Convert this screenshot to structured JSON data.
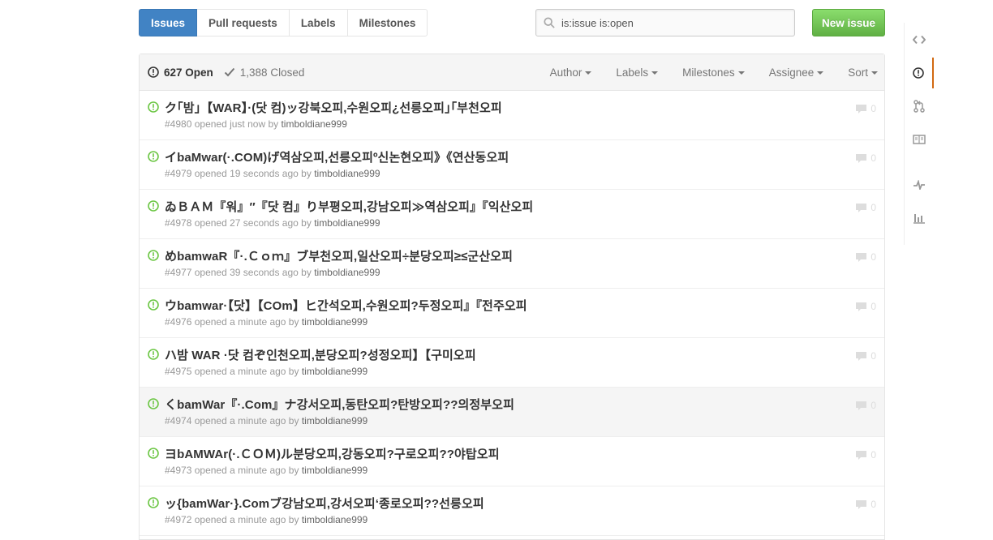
{
  "subnav": {
    "items": [
      {
        "label": "Issues",
        "selected": true
      },
      {
        "label": "Pull requests"
      },
      {
        "label": "Labels"
      },
      {
        "label": "Milestones"
      }
    ]
  },
  "search": {
    "value": "is:issue is:open"
  },
  "new_issue_label": "New issue",
  "states": {
    "open": "627 Open",
    "closed": "1,388 Closed"
  },
  "filters": [
    "Author",
    "Labels",
    "Milestones",
    "Assignee",
    "Sort"
  ],
  "issues": [
    {
      "title": "ク｢밤｣【WAR】·(닷 컴)ッ강북오피,수원오피¿선릉오피｣｢부천오피",
      "number": "#4980",
      "opened": "opened just now by",
      "author": "timboldiane999",
      "comments": "0"
    },
    {
      "title": "イbaMwar(·.COM)げ역삼오피,선릉오피º신논현오피》《연산동오피",
      "number": "#4979",
      "opened": "opened 19 seconds ago by",
      "author": "timboldiane999",
      "comments": "0"
    },
    {
      "title": "ゐＢＡＭ『워』″『닷 컴』り부평오피,강남오피≫역삼오피』『익산오피",
      "number": "#4978",
      "opened": "opened 27 seconds ago by",
      "author": "timboldiane999",
      "comments": "0"
    },
    {
      "title": "めbamwaR『·.Ｃｏｍ』ブ부천오피,일산오피÷분당오피≥≤군산오피",
      "number": "#4977",
      "opened": "opened 39 seconds ago by",
      "author": "timboldiane999",
      "comments": "0"
    },
    {
      "title": "ウbamwar·【닷】【COm】ヒ간석오피,수원오피?두정오피』『전주오피",
      "number": "#4976",
      "opened": "opened a minute ago by",
      "author": "timboldiane999",
      "comments": "0"
    },
    {
      "title": "ハ밤 WAR ·닷 컴ぞ인천오피,분당오피?성정오피】【구미오피",
      "number": "#4975",
      "opened": "opened a minute ago by",
      "author": "timboldiane999",
      "comments": "0"
    },
    {
      "title": "くbamWar『·.Com』ナ강서오피,동탄오피?탄방오피??의정부오피",
      "number": "#4974",
      "opened": "opened a minute ago by",
      "author": "timboldiane999",
      "comments": "0"
    },
    {
      "title": "ヨbAMWAr(·.ＣＯＭ)ル분당오피,강동오피?구로오피??야탑오피",
      "number": "#4973",
      "opened": "opened a minute ago by",
      "author": "timboldiane999",
      "comments": "0"
    },
    {
      "title": "ッ{bamWar·}.Comブ강남오피,강서오피‘종로오피??선릉오피",
      "number": "#4972",
      "opened": "opened a minute ago by",
      "author": "timboldiane999",
      "comments": "0"
    }
  ],
  "sidebar": [
    "code-icon",
    "issues-icon",
    "pull-request-icon",
    "wiki-icon",
    "pulse-icon",
    "graphs-icon"
  ],
  "colors": {
    "accent": "#4183c4",
    "open_green": "#6cc644",
    "new_issue": "#60b044",
    "sidebar_selected": "#d26911"
  }
}
